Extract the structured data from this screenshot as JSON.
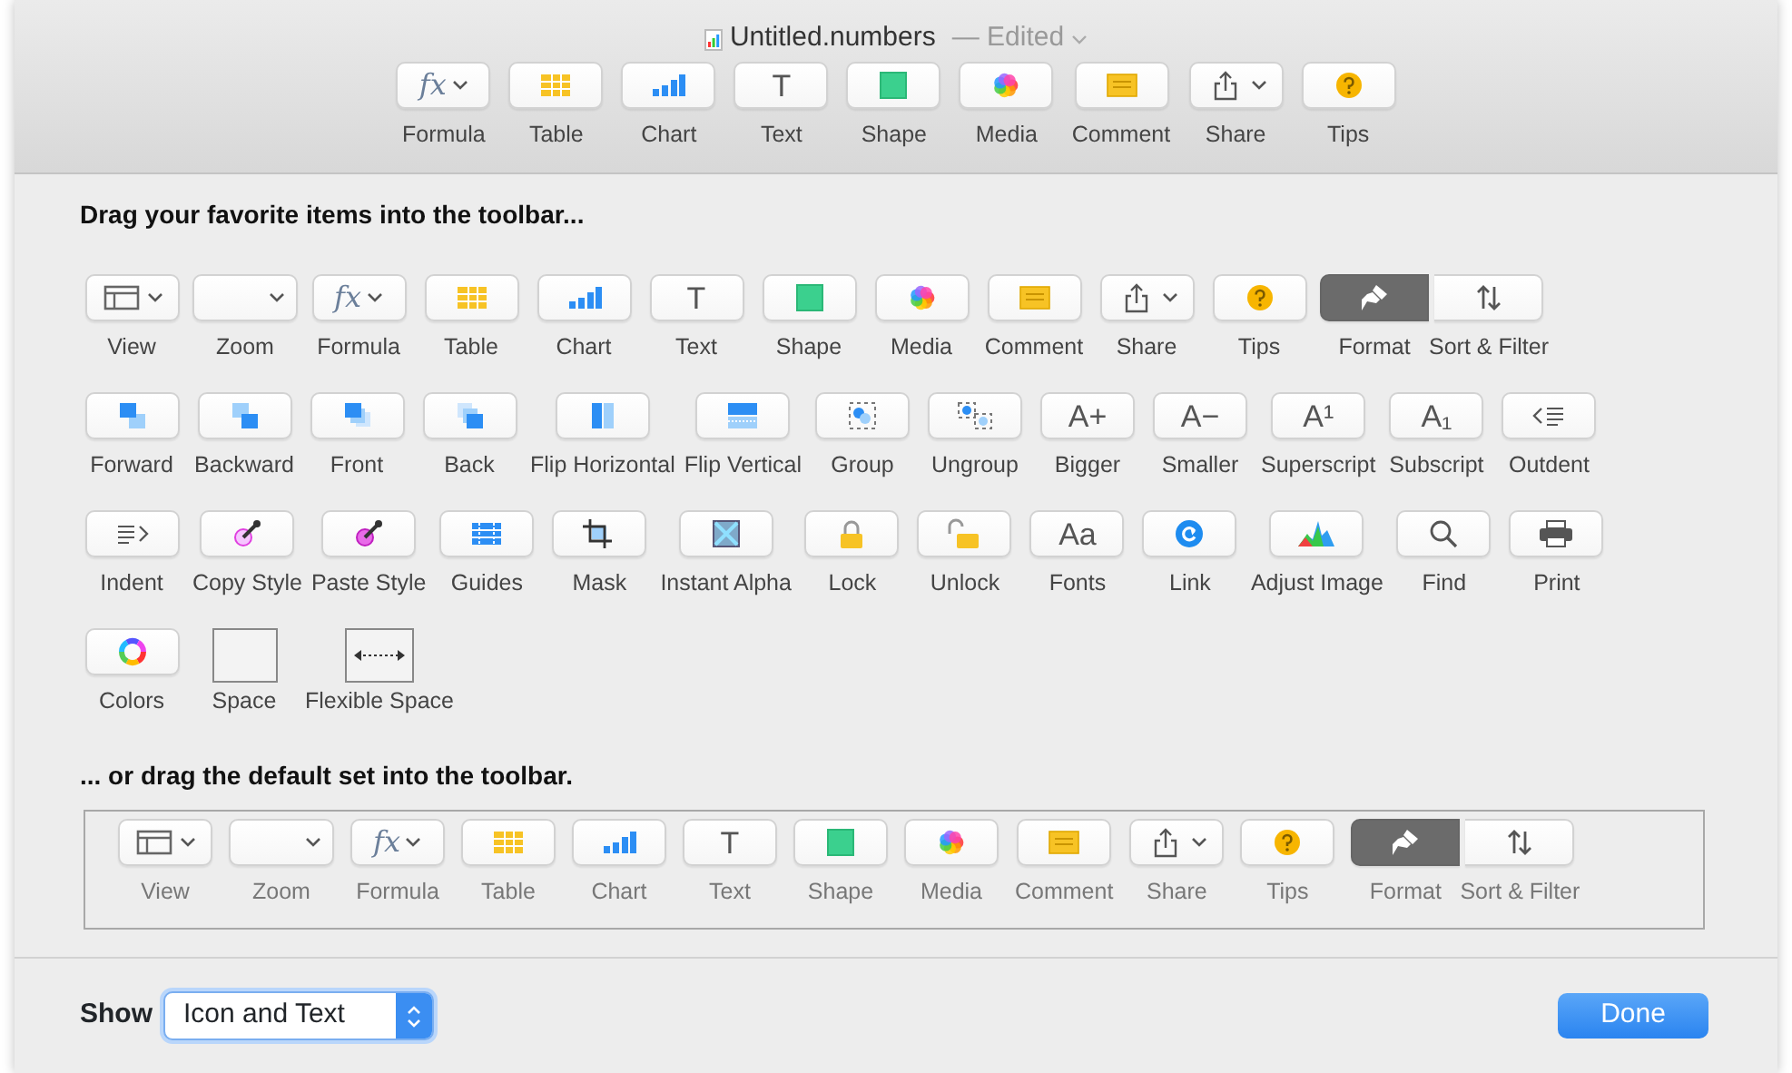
{
  "window": {
    "title": "Untitled.numbers",
    "status": "— Edited"
  },
  "toolbar": [
    {
      "label": "Formula",
      "kind": "glyph",
      "glyph": "fx",
      "menu": true
    },
    {
      "label": "Table",
      "kind": "table"
    },
    {
      "label": "Chart",
      "kind": "chart"
    },
    {
      "label": "Text",
      "kind": "glyph",
      "glyph": "T"
    },
    {
      "label": "Shape",
      "kind": "shape"
    },
    {
      "label": "Media",
      "kind": "media"
    },
    {
      "label": "Comment",
      "kind": "comment"
    },
    {
      "label": "Share",
      "kind": "share",
      "menu": true
    },
    {
      "label": "Tips",
      "kind": "tips"
    }
  ],
  "sheet": {
    "heading": "Drag your favorite items into the toolbar...",
    "rows": [
      [
        {
          "label": "View",
          "kind": "view",
          "menu": true
        },
        {
          "label": "Zoom",
          "kind": "zoom",
          "menu": true
        },
        {
          "label": "Formula",
          "kind": "glyph",
          "glyph": "fx",
          "menu": true
        },
        {
          "label": "Table",
          "kind": "table"
        },
        {
          "label": "Chart",
          "kind": "chart"
        },
        {
          "label": "Text",
          "kind": "glyph",
          "glyph": "T"
        },
        {
          "label": "Shape",
          "kind": "shape"
        },
        {
          "label": "Media",
          "kind": "media"
        },
        {
          "label": "Comment",
          "kind": "comment"
        },
        {
          "label": "Share",
          "kind": "share",
          "menu": true
        },
        {
          "label": "Tips",
          "kind": "tips"
        },
        {
          "kind": "segmented",
          "segments": [
            {
              "label": "Format",
              "kind": "format",
              "on": true
            },
            {
              "label": "Sort & Filter",
              "kind": "sort",
              "on": false
            }
          ]
        }
      ],
      [
        {
          "label": "Forward",
          "kind": "forward"
        },
        {
          "label": "Backward",
          "kind": "backward"
        },
        {
          "label": "Front",
          "kind": "front"
        },
        {
          "label": "Back",
          "kind": "back"
        },
        {
          "label": "Flip Horizontal",
          "kind": "flip-h"
        },
        {
          "label": "Flip Vertical",
          "kind": "flip-v"
        },
        {
          "label": "Group",
          "kind": "group"
        },
        {
          "label": "Ungroup",
          "kind": "ungroup"
        },
        {
          "label": "Bigger",
          "kind": "glyph",
          "glyph": "A+"
        },
        {
          "label": "Smaller",
          "kind": "glyph",
          "glyph": "A−"
        },
        {
          "label": "Superscript",
          "kind": "glyph",
          "glyph": "A¹"
        },
        {
          "label": "Subscript",
          "kind": "glyph",
          "glyph": "A₁"
        },
        {
          "label": "Outdent",
          "kind": "outdent"
        }
      ],
      [
        {
          "label": "Indent",
          "kind": "indent"
        },
        {
          "label": "Copy Style",
          "kind": "copy-style"
        },
        {
          "label": "Paste Style",
          "kind": "paste-style"
        },
        {
          "label": "Guides",
          "kind": "guides"
        },
        {
          "label": "Mask",
          "kind": "mask"
        },
        {
          "label": "Instant Alpha",
          "kind": "instant-alpha"
        },
        {
          "label": "Lock",
          "kind": "lock"
        },
        {
          "label": "Unlock",
          "kind": "unlock"
        },
        {
          "label": "Fonts",
          "kind": "glyph",
          "glyph": "Aa"
        },
        {
          "label": "Link",
          "kind": "link"
        },
        {
          "label": "Adjust Image",
          "kind": "adjust-image"
        },
        {
          "label": "Find",
          "kind": "find"
        },
        {
          "label": "Print",
          "kind": "print"
        }
      ],
      [
        {
          "label": "Colors",
          "kind": "colors"
        },
        {
          "label": "Space",
          "kind": "space"
        },
        {
          "label": "Flexible Space",
          "kind": "flexible-space"
        }
      ]
    ],
    "default_heading": "... or drag the default set into the toolbar.",
    "default_set": [
      {
        "label": "View",
        "kind": "view",
        "menu": true
      },
      {
        "label": "Zoom",
        "kind": "zoom",
        "menu": true
      },
      {
        "label": "Formula",
        "kind": "glyph",
        "glyph": "fx",
        "menu": true
      },
      {
        "label": "Table",
        "kind": "table"
      },
      {
        "label": "Chart",
        "kind": "chart"
      },
      {
        "label": "Text",
        "kind": "glyph",
        "glyph": "T"
      },
      {
        "label": "Shape",
        "kind": "shape"
      },
      {
        "label": "Media",
        "kind": "media"
      },
      {
        "label": "Comment",
        "kind": "comment"
      },
      {
        "label": "Share",
        "kind": "share",
        "menu": true
      },
      {
        "label": "Tips",
        "kind": "tips"
      },
      {
        "kind": "segmented",
        "segments": [
          {
            "label": "Format",
            "kind": "format",
            "on": true
          },
          {
            "label": "Sort & Filter",
            "kind": "sort",
            "on": false
          }
        ]
      }
    ]
  },
  "footer": {
    "show_label": "Show",
    "show_value": "Icon and Text",
    "done": "Done"
  }
}
